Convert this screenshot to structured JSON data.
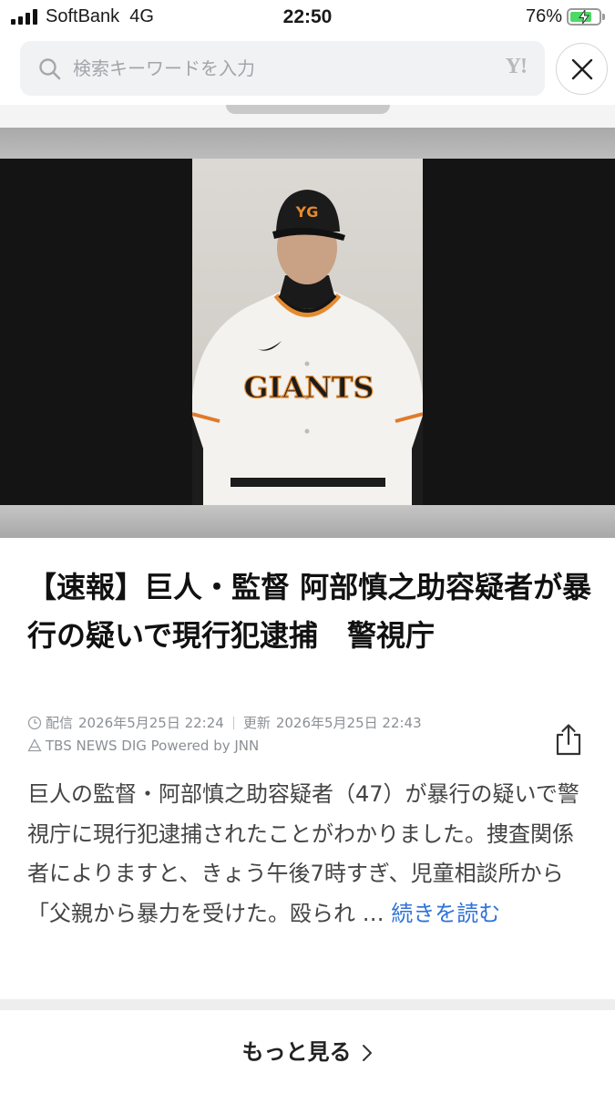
{
  "status_bar": {
    "carrier": "SoftBank",
    "network": "4G",
    "time": "22:50",
    "battery_percent": "76%",
    "battery_level": 0.76,
    "battery_color": "#4cd964"
  },
  "search": {
    "placeholder": "検索キーワードを入力",
    "logo": "Y!",
    "icon": "search-icon",
    "close_icon": "close-icon"
  },
  "article": {
    "image_alt": "GIANTS",
    "headline": "【速報】巨人・監督 阿部慎之助容疑者が暴行の疑いで現行犯逮捕　警視庁",
    "published_label": "配信",
    "published": "2026年5月25日 22:24",
    "updated_label": "更新",
    "updated": "2026年5月25日 22:43",
    "source": "TBS NEWS DIG Powered by JNN",
    "body": "巨人の監督・阿部慎之助容疑者（47）が暴行の疑いで警視庁に現行犯逮捕されたことがわかりました。捜査関係者によりますと、きょう午後7時すぎ、児童相談所から「父親から暴力を受けた。殴られ …",
    "read_more": "続きを読む",
    "share_icon": "share-icon"
  },
  "footer": {
    "more_label": "もっと見る"
  },
  "colors": {
    "link": "#2f73d8",
    "search_bg": "#f1f2f4",
    "text": "#1a1a1a"
  }
}
